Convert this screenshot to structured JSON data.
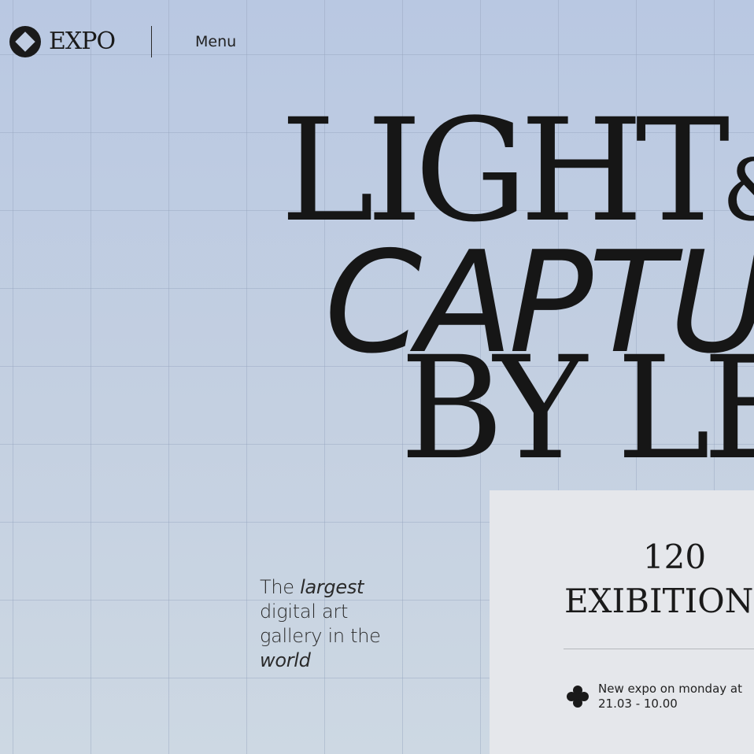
{
  "nav": {
    "logo_text": "EXPO",
    "menu_label": "Menu"
  },
  "hero": {
    "line1": "LIGHT",
    "line1_amp": "&",
    "line2": "CAPTU",
    "line3": "BY LE"
  },
  "tagline": {
    "prefix": "The ",
    "emphasis1": "largest",
    "middle": " digital art gallery in the ",
    "emphasis2": "world"
  },
  "stats_card": {
    "count": "120",
    "label": "EXIBITION",
    "icon": "clover-icon",
    "expo_line1": "New expo on monday at",
    "expo_line2": "21.03 - 10.00"
  },
  "colors": {
    "background_top": "#b9c8e2",
    "background_bottom": "#cdd8e3",
    "card": "#e5e7eb",
    "text": "#161616"
  }
}
